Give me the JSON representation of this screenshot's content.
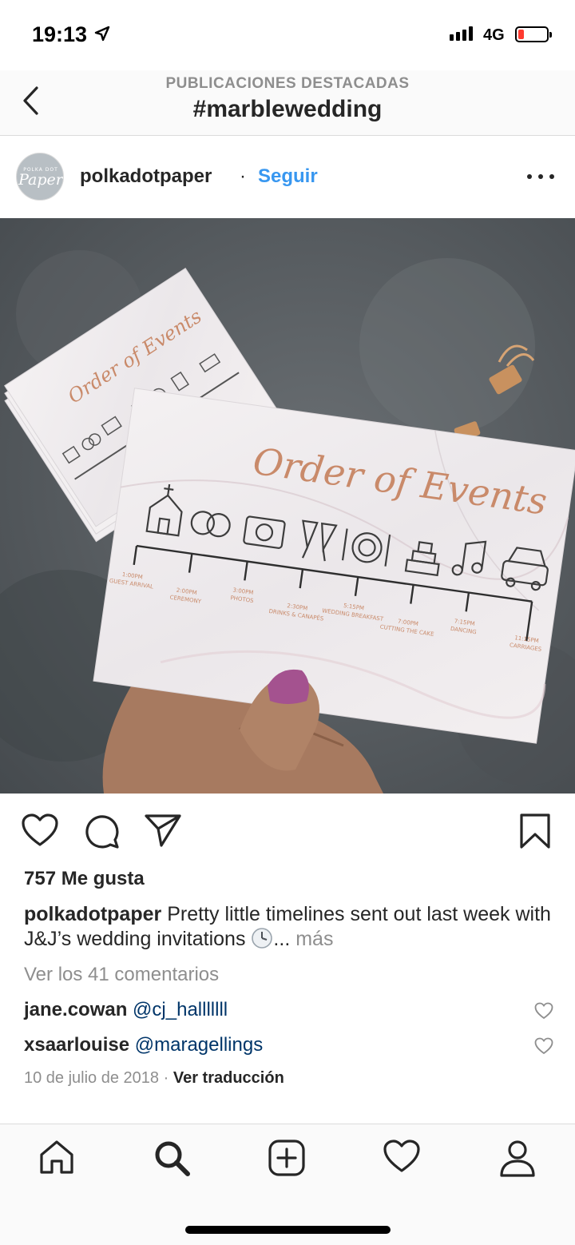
{
  "status_bar": {
    "time": "19:13",
    "network": "4G",
    "battery_level": 0.1,
    "battery_color": "#ff3b30"
  },
  "nav": {
    "subtitle": "PUBLICACIONES DESTACADAS",
    "title": "#marblewedding",
    "back_icon": "chevron-left-icon"
  },
  "post": {
    "avatar_brand_small": "POLKA DOT",
    "avatar_brand_script": "Paper",
    "username": "polkadotpaper",
    "separator": "·",
    "follow_label": "Seguir",
    "follow_color": "#3897f0",
    "more_icon": "more-horizontal-icon",
    "image": {
      "card_title": "Order of Events",
      "accent_color": "#c98a6a",
      "timeline": [
        {
          "time": "1:00PM",
          "label": "GUEST ARRIVAL"
        },
        {
          "time": "2:00PM",
          "label": "CEREMONY"
        },
        {
          "time": "3:00PM",
          "label": "PHOTOS"
        },
        {
          "time": "2:30PM",
          "label": "DRINKS & CANAPÉS"
        },
        {
          "time": "5:15PM",
          "label": "WEDDING BREAKFAST"
        },
        {
          "time": "7:00PM",
          "label": "CUTTING THE CAKE"
        },
        {
          "time": "7:15PM",
          "label": "DANCING"
        },
        {
          "time": "11:15PM",
          "label": "CARRIAGES"
        }
      ]
    },
    "actions": {
      "like_icon": "heart-icon",
      "comment_icon": "comment-icon",
      "share_icon": "send-icon",
      "save_icon": "bookmark-icon"
    },
    "likes": "757 Me gusta",
    "caption_user": "polkadotpaper",
    "caption_text": "Pretty little timelines sent out last week with J&J’s wedding invitations",
    "caption_ellipsis": "...",
    "caption_more": "más",
    "view_comments": "Ver los 41 comentarios",
    "comments": [
      {
        "user": "jane.cowan",
        "mention": "@cj_halllllll"
      },
      {
        "user": "xsaarlouise",
        "mention": "@maragellings"
      }
    ],
    "date": "10 de julio de 2018",
    "meta_separator": "·",
    "translate_label": "Ver traducción"
  },
  "tab_bar": {
    "tabs": [
      "home-icon",
      "search-icon",
      "add-post-icon",
      "activity-heart-icon",
      "profile-icon"
    ],
    "active_tab": "search-icon"
  }
}
